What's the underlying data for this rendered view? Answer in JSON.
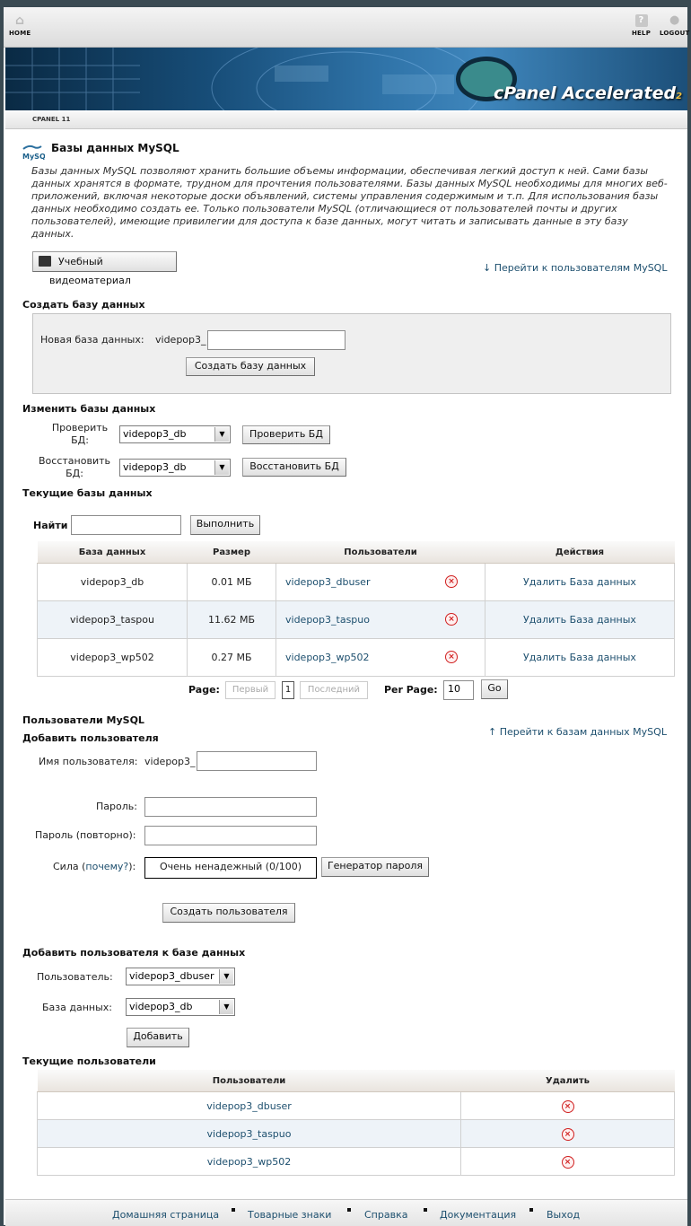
{
  "nav": {
    "home": "HOME",
    "help": "HELP",
    "logout": "LOGOUT"
  },
  "brand": {
    "name": "cPanel",
    "accent": "Accelerated",
    "sub": "2"
  },
  "version_bar": "CPANEL 11",
  "page": {
    "title": "Базы данных MySQL",
    "description": "Базы данных MySQL позволяют хранить большие объемы информации, обеспечивая легкий доступ к ней. Сами базы данных хранятся в формате, трудном для прочтения пользователями. Базы данных MySQL необходимы для многих веб-приложений, включая некоторые доски объявлений, системы управления содержимым и т.п. Для использования базы данных необходимо создать ее. Только пользователи MySQL (отличающиеся от пользователей почты и других пользователей), имеющие привилегии для доступа к базе данных, могут читать и записывать данные в эту базу данных.",
    "video_button": "Учебный видеоматериал",
    "jump_users": "↓ Перейти к пользователям MySQL"
  },
  "create_db": {
    "heading": "Создать базу данных",
    "label": "Новая база данных:",
    "prefix": "videpop3_",
    "value": "",
    "button": "Создать базу данных"
  },
  "modify_db": {
    "heading": "Изменить базы данных",
    "check_label": "Проверить БД:",
    "check_select": "videpop3_db",
    "check_button": "Проверить БД",
    "repair_label": "Восстановить БД:",
    "repair_select": "videpop3_db",
    "repair_button": "Восстановить БД"
  },
  "current_db": {
    "heading": "Текущие базы данных",
    "search_label": "Найти",
    "search_value": "",
    "search_button": "Выполнить",
    "columns": [
      "База данных",
      "Размер",
      "Пользователи",
      "Действия"
    ],
    "rows": [
      {
        "db": "videpop3_db",
        "size": "0.01 МБ",
        "user": "videpop3_dbuser",
        "action": "Удалить База данных"
      },
      {
        "db": "videpop3_taspou",
        "size": "11.62 МБ",
        "user": "videpop3_taspuo",
        "action": "Удалить База данных"
      },
      {
        "db": "videpop3_wp502",
        "size": "0.27 МБ",
        "user": "videpop3_wp502",
        "action": "Удалить База данных"
      }
    ],
    "pagination": {
      "label": "Page:",
      "first": "Первый",
      "current": "1",
      "last": "Последний",
      "per_page_label": "Per Page:",
      "per_page": "10",
      "go": "Go"
    }
  },
  "mysql_users": {
    "heading": "Пользователи MySQL",
    "add_heading": "Добавить пользователя",
    "jump_db": "↑ Перейти к базам данных MySQL",
    "username_label": "Имя пользователя:",
    "username_prefix": "videpop3_",
    "password_label": "Пароль:",
    "password_again_label": "Пароль (повторно):",
    "strength_label": "Сила (",
    "strength_link": "почему?",
    "strength_tail": "):",
    "strength_value": "Очень ненадежный (0/100)",
    "generator_button": "Генератор пароля",
    "create_button": "Создать пользователя"
  },
  "add_user_db": {
    "heading": "Добавить пользователя к базе данных",
    "user_label": "Пользователь:",
    "user_value": "videpop3_dbuser",
    "db_label": "База данных:",
    "db_value": "videpop3_db",
    "button": "Добавить"
  },
  "current_users": {
    "heading": "Текущие пользователи",
    "columns": [
      "Пользователи",
      "Удалить"
    ],
    "rows": [
      "videpop3_dbuser",
      "videpop3_taspuo",
      "videpop3_wp502"
    ]
  },
  "footer": [
    "Домашняя страница",
    "Товарные знаки",
    "Справка",
    "Документация",
    "Выход"
  ]
}
